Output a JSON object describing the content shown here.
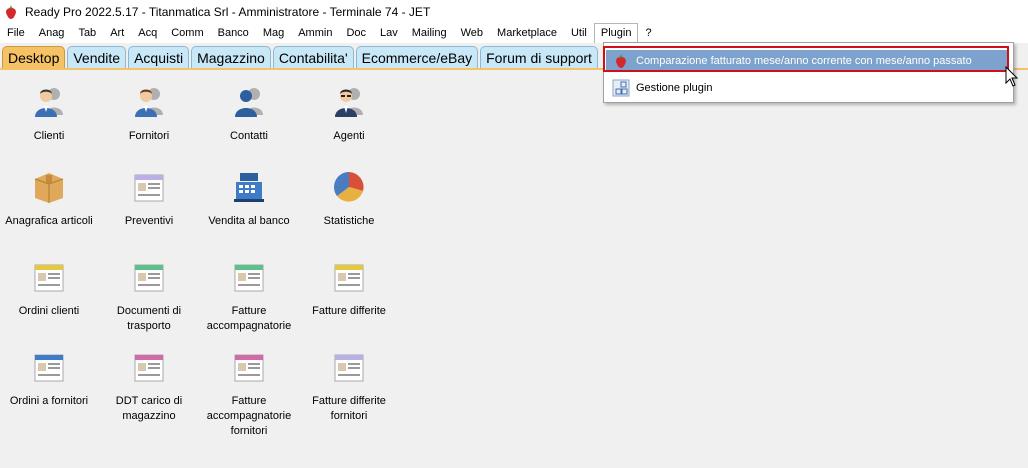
{
  "window": {
    "title": "Ready Pro 2022.5.17 - Titanmatica Srl - Amministratore - Terminale 74 - JET"
  },
  "menubar": {
    "items": [
      "File",
      "Anag",
      "Tab",
      "Art",
      "Acq",
      "Comm",
      "Banco",
      "Mag",
      "Ammin",
      "Doc",
      "Lav",
      "Mailing",
      "Web",
      "Marketplace",
      "Util",
      "Plugin",
      "?"
    ]
  },
  "tabs": [
    "Desktop",
    "Vendite",
    "Acquisti",
    "Magazzino",
    "Contabilita'",
    "Ecommerce/eBay",
    "Forum di support"
  ],
  "desktop": {
    "row1": [
      {
        "label": "Clienti",
        "icon": "person-icon"
      },
      {
        "label": "Fornitori",
        "icon": "person-icon"
      },
      {
        "label": "Contatti",
        "icon": "contacts-icon"
      },
      {
        "label": "Agenti",
        "icon": "agent-icon"
      }
    ],
    "row2": [
      {
        "label": "Anagrafica articoli",
        "icon": "box-icon"
      },
      {
        "label": "Preventivi",
        "icon": "document-icon"
      },
      {
        "label": "Vendita al banco",
        "icon": "cash-register-icon"
      },
      {
        "label": "Statistiche",
        "icon": "pie-chart-icon"
      }
    ],
    "row3": [
      {
        "label": "Ordini clienti",
        "icon": "document-icon"
      },
      {
        "label": "Documenti di trasporto",
        "icon": "document-icon"
      },
      {
        "label": "Fatture accompagnatorie",
        "icon": "document-icon"
      },
      {
        "label": "Fatture differite",
        "icon": "document-icon"
      }
    ],
    "row4": [
      {
        "label": "Ordini a fornitori",
        "icon": "document-icon"
      },
      {
        "label": "DDT carico di magazzino",
        "icon": "document-icon"
      },
      {
        "label": "Fatture accompagnatorie fornitori",
        "icon": "document-icon"
      },
      {
        "label": "Fatture differite fornitori",
        "icon": "document-icon"
      }
    ]
  },
  "plugin_menu": {
    "items": [
      {
        "label": "Comparazione fatturato mese/anno corrente con mese/anno passato",
        "icon": "strawberry-icon"
      },
      {
        "label": "Gestione plugin",
        "icon": "plugin-grid-icon"
      }
    ]
  },
  "colors": {
    "active_tab": "#f5c266",
    "inactive_tab": "#c8e8f8",
    "highlight": "#7da2ce",
    "annotation_box": "#d01018"
  }
}
